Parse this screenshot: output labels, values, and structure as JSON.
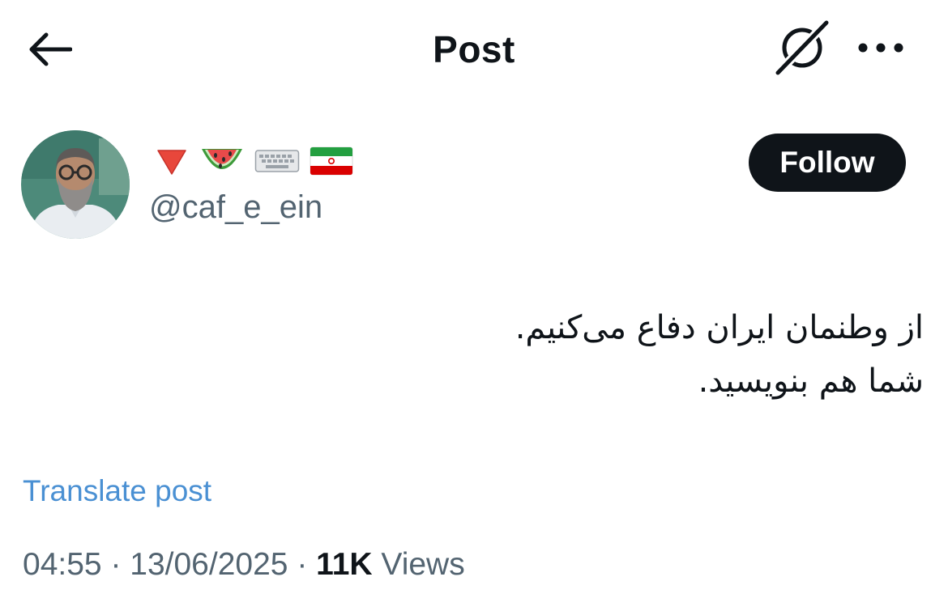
{
  "header": {
    "title": "Post",
    "back_icon": "arrow-left-icon",
    "grok_icon": "grok-icon",
    "more_icon": "more-horizontal-icon"
  },
  "author": {
    "display_name_emojis": [
      "🔻",
      "🍉",
      "⌨️",
      "🇮🇷"
    ],
    "handle": "@caf_e_ein"
  },
  "follow_button": {
    "label": "Follow"
  },
  "post": {
    "lines": [
      "از وطنمان ایران دفاع می‌کنیم.",
      "شما هم بنویسید."
    ]
  },
  "translate_link": "Translate post",
  "meta": {
    "time": "04:55",
    "sep1": " · ",
    "date": "13/06/2025",
    "sep2": " · ",
    "views_count": "11K",
    "views_label": " Views"
  },
  "colors": {
    "text": "#0f1419",
    "secondary": "#536471",
    "link": "#4a90d3",
    "button_bg": "#0f1419"
  }
}
